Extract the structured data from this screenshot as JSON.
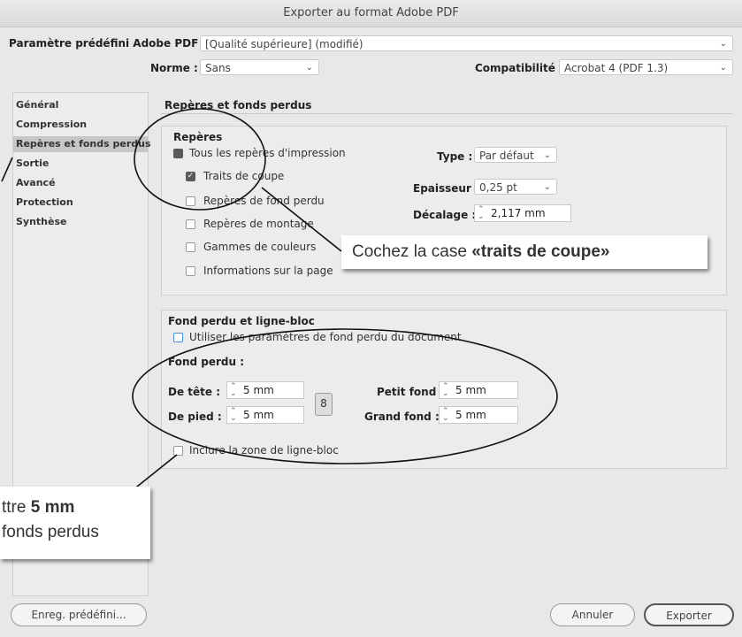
{
  "window": {
    "title": "Exporter au format Adobe PDF"
  },
  "preset": {
    "label": "Paramètre prédéfini Adobe PDF :",
    "value": "[Qualité supérieure] (modifié)"
  },
  "standard": {
    "label": "Norme :",
    "value": "Sans"
  },
  "compat": {
    "label": "Compatibilité :",
    "value": "Acrobat 4 (PDF 1.3)"
  },
  "sidebar": {
    "items": [
      {
        "label": "Général"
      },
      {
        "label": "Compression"
      },
      {
        "label": "Repères et fonds perdus",
        "selected": true
      },
      {
        "label": "Sortie"
      },
      {
        "label": "Avancé"
      },
      {
        "label": "Protection"
      },
      {
        "label": "Synthèse"
      }
    ]
  },
  "section": {
    "title": "Repères et fonds perdus"
  },
  "marks": {
    "title": "Repères",
    "all": "Tous les repères d'impression",
    "crop": "Traits de coupe",
    "bleed": "Repères de fond perdu",
    "reg": "Repères de montage",
    "color": "Gammes de couleurs",
    "info": "Informations sur la page",
    "type_label": "Type :",
    "type_value": "Par défaut",
    "weight_label": "Epaisseur :",
    "weight_value": "0,25 pt",
    "offset_label": "Décalage :",
    "offset_value": "2,117 mm"
  },
  "bleed": {
    "title": "Fond perdu et ligne-bloc",
    "use_doc": "Utiliser les paramètres de fond perdu du document",
    "subtitle": "Fond perdu :",
    "top_label": "De tête :",
    "top_value": "5 mm",
    "bottom_label": "De pied :",
    "bottom_value": "5 mm",
    "inside_label": "Petit fond :",
    "inside_value": "5 mm",
    "outside_label": "Grand fond :",
    "outside_value": "5 mm",
    "slug": "Inclure la zone de ligne-bloc"
  },
  "buttons": {
    "save_preset": "Enreg. prédéfini...",
    "cancel": "Annuler",
    "export": "Exporter"
  },
  "callouts": {
    "crop_prefix": "Cochez la case ",
    "crop_bold": "«traits de coupe»",
    "bleed_line1_prefix": "ttre ",
    "bleed_line1_bold": "5 mm",
    "bleed_line2": "fonds perdus"
  }
}
